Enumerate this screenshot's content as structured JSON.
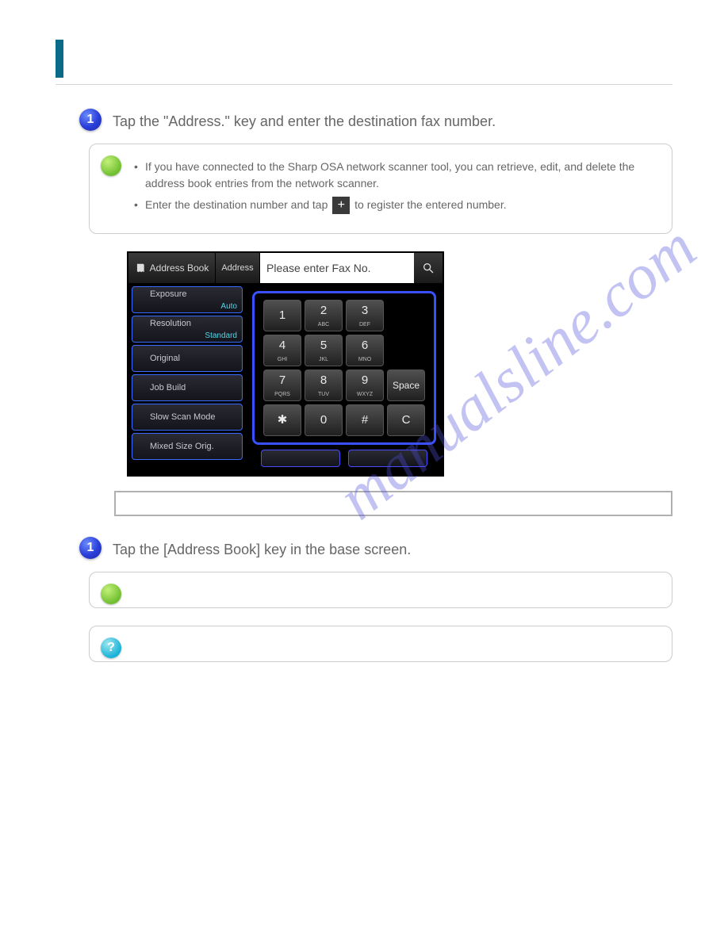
{
  "watermark": "manualsline.com",
  "header_title": "",
  "step1": {
    "num": "1",
    "text": "Tap the \"Address.\" key and enter the destination fax number.",
    "tips": [
      "If you have connected to the Sharp OSA network scanner tool, you can retrieve, edit, and delete the address book entries from the network scanner.",
      "Enter the destination number and tap"
    ],
    "tip_tail": "to register the entered number."
  },
  "fax": {
    "address_book": "Address Book",
    "address": "Address",
    "placeholder": "Please enter Fax No.",
    "options": {
      "exposure": {
        "label": "Exposure",
        "value": "Auto"
      },
      "resolution": {
        "label": "Resolution",
        "value": "Standard"
      },
      "original": {
        "label": "Original"
      },
      "job_build": {
        "label": "Job Build"
      },
      "slow_scan": {
        "label": "Slow Scan Mode"
      },
      "mixed": {
        "label": "Mixed Size Orig."
      }
    },
    "keys": {
      "k1": "1",
      "k2": "2",
      "k2s": "ABC",
      "k3": "3",
      "k3s": "DEF",
      "k4": "4",
      "k4s": "GHI",
      "k5": "5",
      "k5s": "JKL",
      "k6": "6",
      "k6s": "MNO",
      "k7": "7",
      "k7s": "PQRS",
      "k8": "8",
      "k8s": "TUV",
      "k9": "9",
      "k9s": "WXYZ",
      "space": "Space",
      "star": "✱",
      "k0": "0",
      "hash": "#",
      "c": "C"
    }
  },
  "note": "",
  "subheading": "",
  "step2": {
    "num": "1",
    "text": "Tap the [Address Book] key in the base screen.",
    "after": "",
    "tip": "",
    "ref": ""
  }
}
